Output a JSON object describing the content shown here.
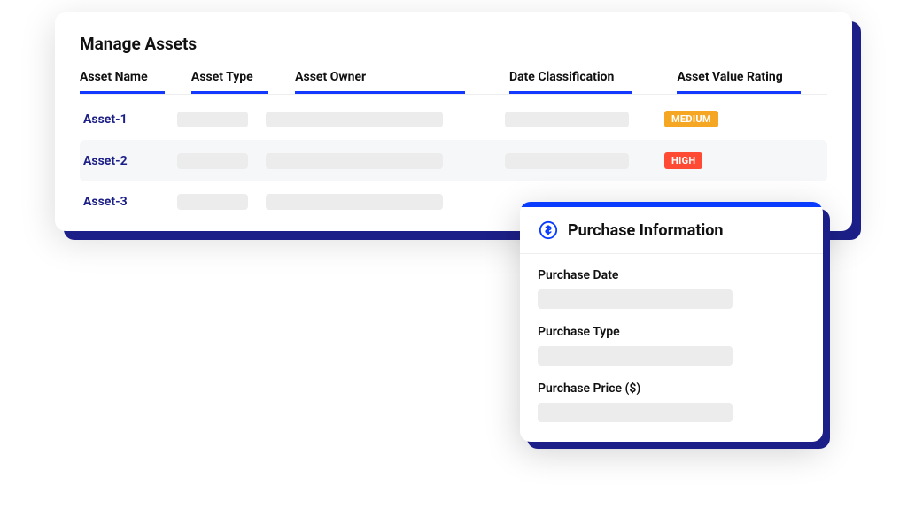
{
  "title": "Manage Assets",
  "columns": {
    "name": "Asset Name",
    "type": "Asset Type",
    "owner": "Asset Owner",
    "date": "Date Classification",
    "rating": "Asset Value Rating"
  },
  "rows": [
    {
      "name": "Asset-1",
      "rating": "MEDIUM",
      "rating_level": "medium"
    },
    {
      "name": "Asset-2",
      "rating": "HIGH",
      "rating_level": "high"
    },
    {
      "name": "Asset-3",
      "rating": "",
      "rating_level": ""
    }
  ],
  "popup": {
    "title": "Purchase Information",
    "fields": {
      "date": "Purchase Date",
      "type": "Purchase Type",
      "price": "Purchase Price ($)"
    }
  }
}
